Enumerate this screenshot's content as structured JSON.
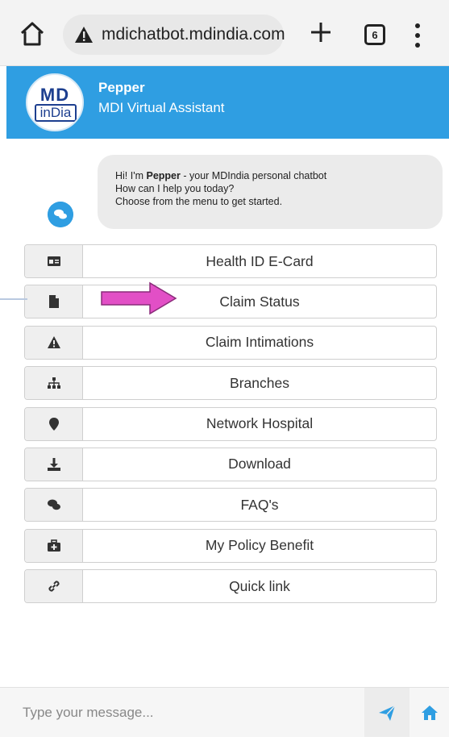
{
  "browser": {
    "url": "mdichatbot.mdindia.com",
    "tab_count": "6",
    "icons": {
      "home": "home-icon",
      "warning": "warning-icon",
      "new_tab": "plus-icon",
      "tabs": "tabs-icon",
      "menu": "more-vert-icon"
    }
  },
  "header": {
    "logo_top": "MD",
    "logo_bottom": "inDia",
    "bot_name": "Pepper",
    "bot_subtitle": "MDI Virtual Assistant",
    "bg_color": "#2f9ee2"
  },
  "greeting": {
    "line1_prefix": "Hi! I'm ",
    "line1_name": "Pepper",
    "line1_suffix": " - your MDIndia personal chatbot",
    "line2": "How can I help you today?",
    "line3": "Choose from the menu to get started."
  },
  "menu": [
    {
      "label": "Health ID E-Card",
      "icon": "id-card-icon"
    },
    {
      "label": "Claim Status",
      "icon": "file-icon"
    },
    {
      "label": "Claim Intimations",
      "icon": "warning-icon"
    },
    {
      "label": "Branches",
      "icon": "sitemap-icon"
    },
    {
      "label": "Network Hospital",
      "icon": "map-marker-icon"
    },
    {
      "label": "Download",
      "icon": "download-icon"
    },
    {
      "label": "FAQ's",
      "icon": "comments-icon"
    },
    {
      "label": "My Policy Benefit",
      "icon": "medkit-icon"
    },
    {
      "label": "Quick link",
      "icon": "link-icon"
    }
  ],
  "annotation": {
    "color": "#e24fc6",
    "icon": "arrow-right-icon"
  },
  "input": {
    "placeholder": "Type your message...",
    "value": "",
    "send_icon": "paper-plane-icon",
    "home_icon": "home-icon"
  },
  "colors": {
    "accent": "#2f9ee2"
  }
}
